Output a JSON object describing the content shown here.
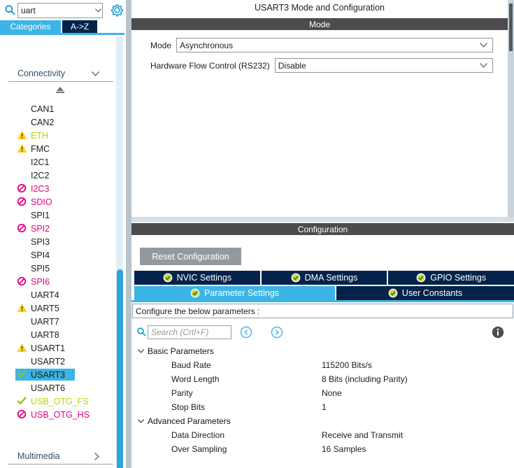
{
  "sidebar": {
    "search": {
      "value": "uart"
    },
    "tabs": [
      {
        "label": "Categories"
      },
      {
        "label": "A->Z"
      }
    ],
    "section_top": {
      "label": "Connectivity"
    },
    "section_bottom": {
      "label": "Multimedia"
    },
    "items": [
      {
        "label": "CAN1",
        "icon": "none",
        "color": "default",
        "selected": false
      },
      {
        "label": "CAN2",
        "icon": "none",
        "color": "default",
        "selected": false
      },
      {
        "label": "ETH",
        "icon": "warning",
        "color": "green",
        "selected": false
      },
      {
        "label": "FMC",
        "icon": "warning",
        "color": "default",
        "selected": false
      },
      {
        "label": "I2C1",
        "icon": "none",
        "color": "default",
        "selected": false
      },
      {
        "label": "I2C2",
        "icon": "none",
        "color": "default",
        "selected": false
      },
      {
        "label": "I2C3",
        "icon": "blocked",
        "color": "magenta",
        "selected": false
      },
      {
        "label": "SDIO",
        "icon": "blocked",
        "color": "magenta",
        "selected": false
      },
      {
        "label": "SPI1",
        "icon": "none",
        "color": "default",
        "selected": false
      },
      {
        "label": "SPI2",
        "icon": "blocked",
        "color": "magenta",
        "selected": false
      },
      {
        "label": "SPI3",
        "icon": "none",
        "color": "default",
        "selected": false
      },
      {
        "label": "SPI4",
        "icon": "none",
        "color": "default",
        "selected": false
      },
      {
        "label": "SPI5",
        "icon": "none",
        "color": "default",
        "selected": false
      },
      {
        "label": "SPI6",
        "icon": "blocked",
        "color": "magenta",
        "selected": false
      },
      {
        "label": "UART4",
        "icon": "none",
        "color": "default",
        "selected": false
      },
      {
        "label": "UART5",
        "icon": "warning",
        "color": "default",
        "selected": false
      },
      {
        "label": "UART7",
        "icon": "none",
        "color": "default",
        "selected": false
      },
      {
        "label": "UART8",
        "icon": "none",
        "color": "default",
        "selected": false
      },
      {
        "label": "USART1",
        "icon": "warning",
        "color": "default",
        "selected": false
      },
      {
        "label": "USART2",
        "icon": "none",
        "color": "default",
        "selected": false
      },
      {
        "label": "USART3",
        "icon": "check",
        "color": "default",
        "selected": true
      },
      {
        "label": "USART6",
        "icon": "none",
        "color": "default",
        "selected": false
      },
      {
        "label": "USB_OTG_FS",
        "icon": "check",
        "color": "green",
        "selected": false
      },
      {
        "label": "USB_OTG_HS",
        "icon": "blocked",
        "color": "magenta",
        "selected": false
      }
    ]
  },
  "main": {
    "title": "USART3 Mode and Configuration",
    "mode_section": {
      "header": "Mode",
      "fields": [
        {
          "label": "Mode",
          "value": "Asynchronous"
        },
        {
          "label": "Hardware Flow Control (RS232)",
          "value": "Disable"
        }
      ]
    },
    "config_section": {
      "header": "Configuration",
      "reset_button": "Reset Configuration",
      "tabs_row1": [
        "NVIC Settings",
        "DMA Settings",
        "GPIO Settings"
      ],
      "tabs_row2": [
        "Parameter Settings",
        "User Constants"
      ],
      "active_tab": "Parameter Settings",
      "banner": "Configure the below parameters :",
      "search_placeholder": "Search (Crtl+F)",
      "groups": [
        {
          "label": "Basic Parameters",
          "params": [
            {
              "name": "Baud Rate",
              "value": "115200 Bits/s"
            },
            {
              "name": "Word Length",
              "value": "8 Bits (including Parity)"
            },
            {
              "name": "Parity",
              "value": "None"
            },
            {
              "name": "Stop Bits",
              "value": "1"
            }
          ]
        },
        {
          "label": "Advanced Parameters",
          "params": [
            {
              "name": "Data Direction",
              "value": "Receive and Transmit"
            },
            {
              "name": "Over Sampling",
              "value": "16 Samples"
            }
          ]
        }
      ]
    }
  },
  "icons": {
    "warning": "yellow-triangle-exclamation",
    "blocked": "magenta-no-entry-circle",
    "check": "green-checkmark",
    "tab_badge": "green-circle-check",
    "accent_blue": "#3cb4e6",
    "navy": "#03234b",
    "dark_bar": "#4c4c4e",
    "magenta": "#e5007d",
    "yellow_green": "#bcd400"
  }
}
